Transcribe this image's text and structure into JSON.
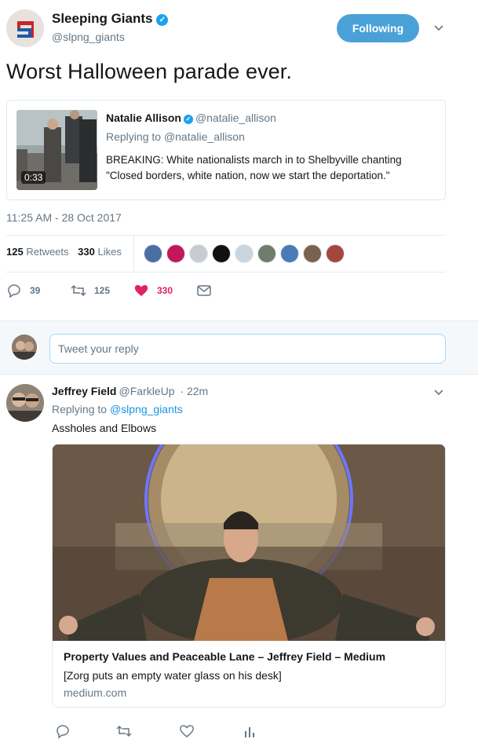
{
  "tweet": {
    "author_name": "Sleeping Giants",
    "author_handle": "@slpng_giants",
    "follow_label": "Following",
    "text": "Worst Halloween parade ever.",
    "quote": {
      "name": "Natalie Allison",
      "handle": "@natalie_allison",
      "replying_prefix": "Replying to ",
      "replying_handle": "@natalie_allison",
      "duration": "0:33",
      "body": "BREAKING: White nationalists march in to Shelbyville chanting \"Closed borders, white nation, now we start the deportation.\""
    },
    "timestamp": "11:25 AM - 28 Oct 2017",
    "retweets_count": "125",
    "retweets_label": "Retweets",
    "likes_count": "330",
    "likes_label": "Likes",
    "actions": {
      "reply_count": "39",
      "retweet_count": "125",
      "like_count": "330"
    }
  },
  "reply_box": {
    "placeholder": "Tweet your reply"
  },
  "reply_tweet": {
    "name": "Jeffrey Field",
    "handle": "@FarkleUp",
    "time": "· 22m",
    "replying_prefix": "Replying to ",
    "replying_handle": "@slpng_giants",
    "text": "Assholes and Elbows",
    "card": {
      "title": "Property Values and Peaceable Lane – Jeffrey Field – Medium",
      "description": "[Zorg puts an empty water glass on his desk]",
      "domain": "medium.com"
    }
  },
  "colors": {
    "accent": "#1da1f2",
    "follow_button": "#4aa1d8",
    "like": "#e0245e",
    "muted": "#657786"
  }
}
